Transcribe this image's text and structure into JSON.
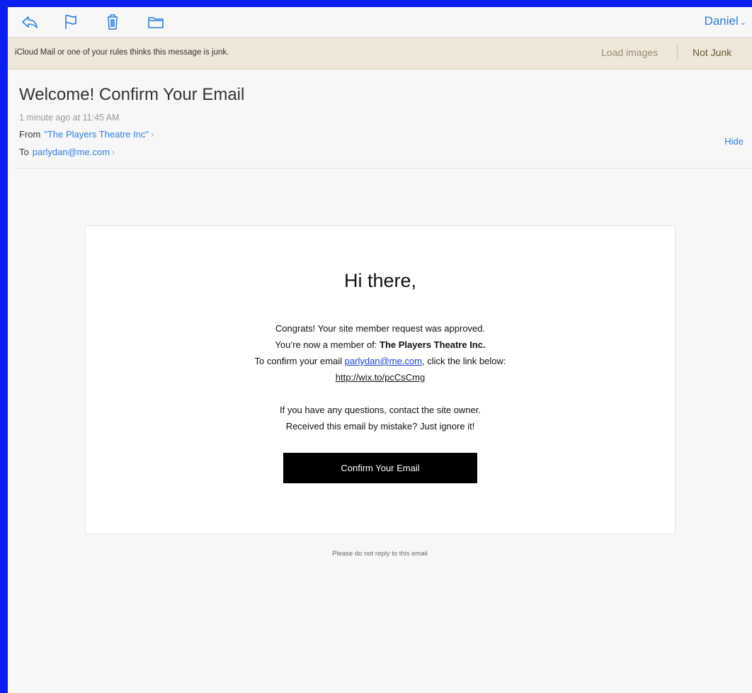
{
  "toolbar": {
    "icons": [
      "reply-icon",
      "flag-icon",
      "trash-icon",
      "folder-icon"
    ],
    "account_name": "Daniel",
    "accent": "#2f7de1"
  },
  "junk_bar": {
    "message": "iCloud Mail or one of your rules thinks this message is junk.",
    "load_images": "Load images",
    "not_junk": "Not Junk"
  },
  "header": {
    "subject": "Welcome! Confirm Your Email",
    "date": "1 minute ago at 11:45 AM",
    "from_label": "From",
    "from_value": "\"The Players Theatre Inc\"",
    "to_label": "To",
    "to_value": "parlydan@me.com",
    "hide": "Hide"
  },
  "email": {
    "greeting": "Hi there,",
    "line1": "Congrats! Your site member request was approved.",
    "line2_prefix": "You’re now a member of: ",
    "line2_site": "The Players Theatre Inc.",
    "line3_prefix": "To confirm your email ",
    "line3_email": "parlydan@me.com",
    "line3_suffix": ", click the link below:",
    "link": "http://wix.to/pcCsCmg",
    "line4": "If you have any questions, contact the site owner.",
    "line5": "Received this email by mistake? Just ignore it!",
    "cta": "Confirm Your Email"
  },
  "footer": {
    "note": "Please do not reply to this email"
  }
}
